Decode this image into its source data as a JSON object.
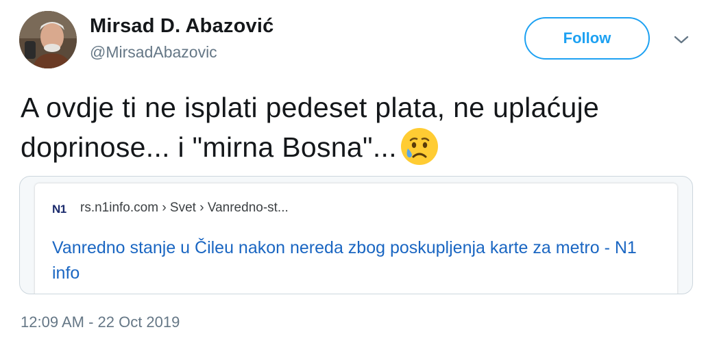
{
  "tweet": {
    "author_name": "Mirsad D. Abazović",
    "author_handle": "@MirsadAbazovic",
    "follow_label": "Follow",
    "text_line1": "A ovdje ti ne isplati pedeset plata, ne uplaćuje",
    "text_line2": "doprinose... i \"mirna Bosna\"...",
    "emoji": "sad-but-relieved-face",
    "timestamp": "12:09 AM - 22 Oct 2019"
  },
  "link_card": {
    "source_logo": "N1",
    "breadcrumb": "rs.n1info.com › Svet › Vanredno-st...",
    "title": "Vanredno stanje u Čileu nakon nereda zbog poskupljenja karte za metro - N1 info"
  },
  "colors": {
    "accent": "#1da1f2",
    "link": "#1a66c2",
    "secondary_text": "#657786"
  }
}
